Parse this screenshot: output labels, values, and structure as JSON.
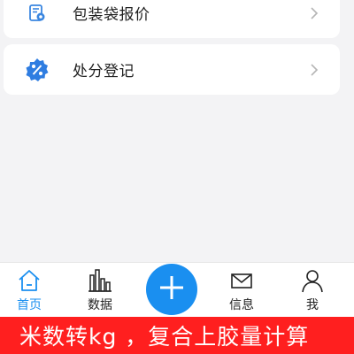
{
  "menu": {
    "items": [
      {
        "label": "包装袋报价",
        "icon": "price-sheet-icon"
      },
      {
        "label": "处分登记",
        "icon": "discount-badge-icon"
      }
    ]
  },
  "tabbar": {
    "tabs": [
      {
        "label": "首页",
        "icon": "home-icon",
        "active": true
      },
      {
        "label": "数据",
        "icon": "bar-chart-icon",
        "active": false
      },
      {
        "label": "信息",
        "icon": "mail-icon",
        "active": false
      },
      {
        "label": "我",
        "icon": "user-icon",
        "active": false
      }
    ],
    "add_icon": "plus-icon"
  },
  "banner": {
    "text": "米数转kg ，复合上胶量计算"
  },
  "colors": {
    "accent": "#1a8ff0",
    "banner": "#ff1f1f",
    "background": "#f3f3f5"
  }
}
